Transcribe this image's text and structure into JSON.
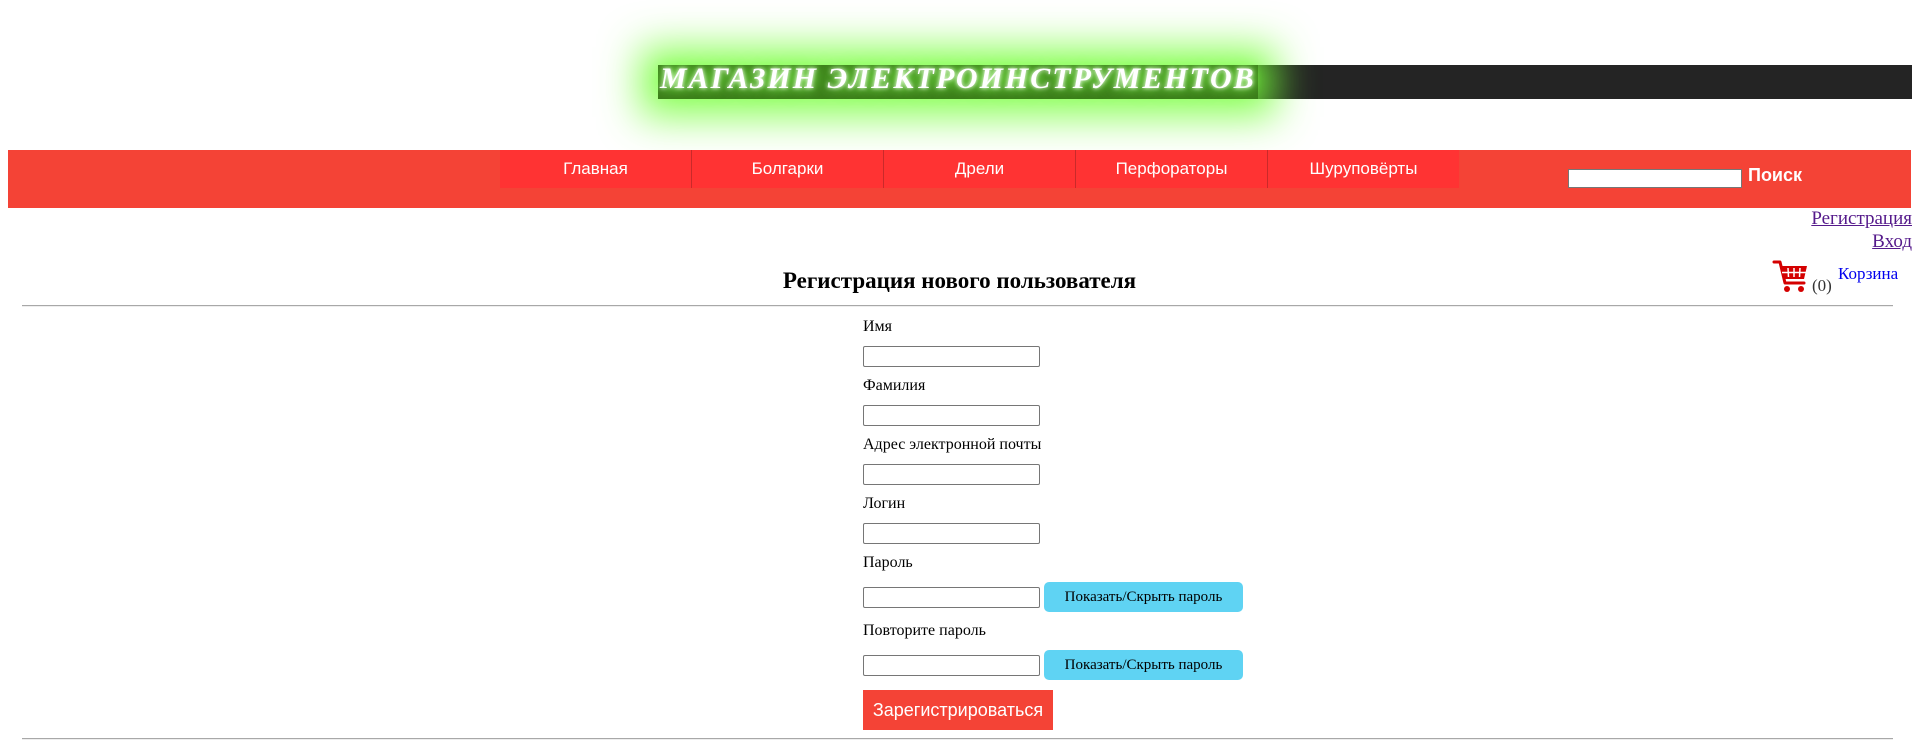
{
  "header": {
    "site_title": "МАГАЗИН ЭЛЕКТРОИНСТРУМЕНТОВ"
  },
  "nav": {
    "items": [
      "Главная",
      "Болгарки",
      "Дрели",
      "Перфораторы",
      "Шуруповёрты"
    ],
    "search_button": "Поиск",
    "search_value": ""
  },
  "account": {
    "register_link": "Регистрация",
    "login_link": "Вход",
    "cart_count": "(0)",
    "cart_label": "Корзина"
  },
  "form": {
    "title": "Регистрация нового пользователя",
    "fields": {
      "first_name": {
        "label": "Имя",
        "value": ""
      },
      "last_name": {
        "label": "Фамилия",
        "value": ""
      },
      "email": {
        "label": "Адрес электронной почты",
        "value": ""
      },
      "login": {
        "label": "Логин",
        "value": ""
      },
      "password": {
        "label": "Пароль",
        "value": ""
      },
      "password_repeat": {
        "label": "Повторите пароль",
        "value": ""
      }
    },
    "toggle_password_label": "Показать/Скрыть пароль",
    "submit_label": "Зарегистрироваться"
  },
  "colors": {
    "nav_background": "#f44336",
    "nav_item": "#ff3333",
    "banner": "#242424",
    "glow": "#7dff4a",
    "toggle_button": "#5fd3f3",
    "submit_button": "#f44336",
    "cart_icon": "#d40000"
  },
  "icons": {
    "cart": "shopping-cart-icon"
  }
}
